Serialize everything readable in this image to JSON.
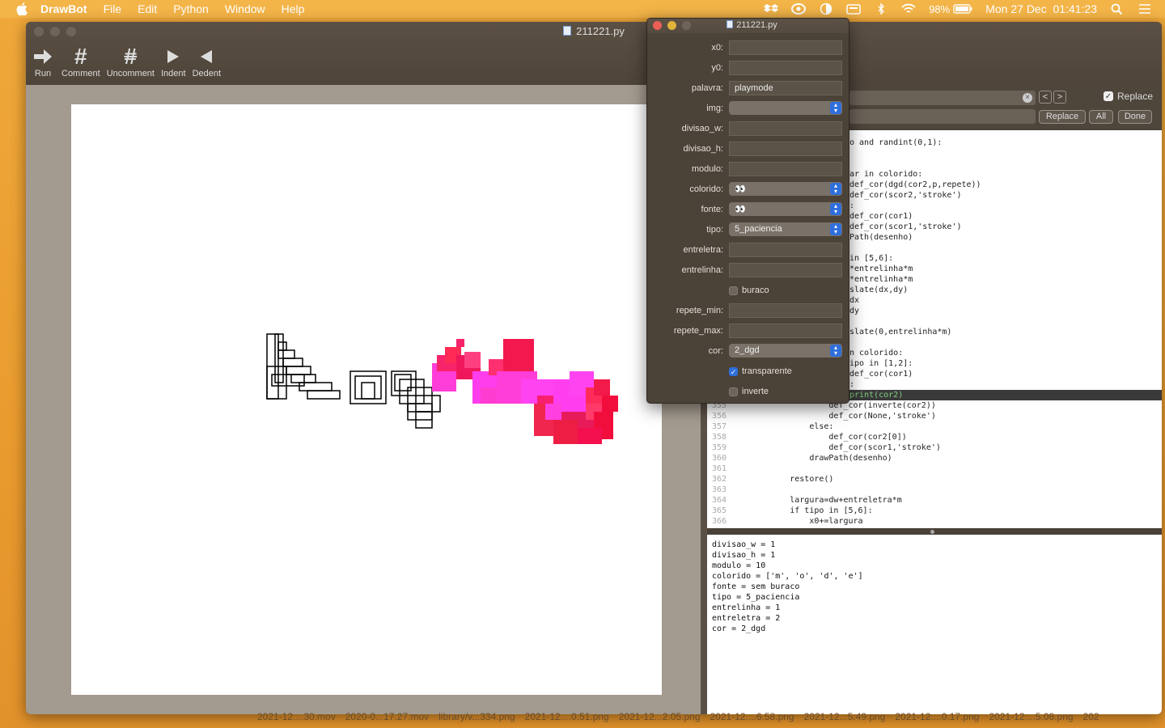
{
  "menubar": {
    "app": "DrawBot",
    "items": [
      "File",
      "Edit",
      "Python",
      "Window",
      "Help"
    ],
    "battery": "98%",
    "clock": "Mon 27 Dec  01:41:23"
  },
  "window": {
    "title": "211221.py",
    "toolbar": [
      "Run",
      "Comment",
      "Uncomment",
      "Indent",
      "Dedent"
    ]
  },
  "find": {
    "replace_label": "Replace",
    "btn_replace": "Replace",
    "btn_all": "All",
    "btn_done": "Done"
  },
  "code_lines": [
    {
      "n": "",
      "t": "o and randint(0,1):"
    },
    {
      "n": "",
      "t": ""
    },
    {
      "n": "",
      "t": ""
    },
    {
      "n": "",
      "t": "ar in colorido:"
    },
    {
      "n": "",
      "t": "def_cor(dgd(cor2,p,repete))"
    },
    {
      "n": "",
      "t": "def_cor(scor2,'stroke')"
    },
    {
      "n": "",
      "t": ":"
    },
    {
      "n": "",
      "t": "def_cor(cor1)"
    },
    {
      "n": "",
      "t": "def_cor(scor1,'stroke')"
    },
    {
      "n": "",
      "t": "Path(desenho)"
    },
    {
      "n": "",
      "t": ""
    },
    {
      "n": "",
      "t": "in [5,6]:"
    },
    {
      "n": "",
      "t": "*entrelinha*m"
    },
    {
      "n": "",
      "t": "*entrelinha*m"
    },
    {
      "n": "",
      "t": "slate(dx,dy)"
    },
    {
      "n": "",
      "t": "dx"
    },
    {
      "n": "",
      "t": "dy"
    },
    {
      "n": "",
      "t": ""
    },
    {
      "n": "",
      "t": "slate(0,entrelinha*m)"
    },
    {
      "n": "",
      "t": ""
    },
    {
      "n": "",
      "t": "n colorido:"
    },
    {
      "n": "",
      "t": "ipo in [1,2]:"
    },
    {
      "n": "",
      "t": "def_cor(cor1)"
    },
    {
      "n": "",
      "t": ":"
    },
    {
      "n": "",
      "t": "print(cor2)"
    },
    {
      "n": "355",
      "t": "                    def_cor(inverte(cor2))"
    },
    {
      "n": "356",
      "t": "                    def_cor(None,'stroke')"
    },
    {
      "n": "357",
      "t": "                else:"
    },
    {
      "n": "358",
      "t": "                    def_cor(cor2[0])"
    },
    {
      "n": "359",
      "t": "                    def_cor(scor1,'stroke')"
    },
    {
      "n": "360",
      "t": "                drawPath(desenho)"
    },
    {
      "n": "361",
      "t": ""
    },
    {
      "n": "362",
      "t": "            restore()"
    },
    {
      "n": "363",
      "t": ""
    },
    {
      "n": "364",
      "t": "            largura=dw+entreletra*m"
    },
    {
      "n": "365",
      "t": "            if tipo in [5,6]:"
    },
    {
      "n": "366",
      "t": "                x0+=largura"
    }
  ],
  "console": [
    "divisao_w = 1",
    "divisao_h = 1",
    "modulo = 10",
    "colorido = ['m', 'o', 'd', 'e']",
    "fonte = sem buraco",
    "tipo = 5_paciencia",
    "entrelinha = 1",
    "entreletra = 2",
    "cor = 2_dgd"
  ],
  "varpanel": {
    "title": "211221.py",
    "rows": [
      {
        "label": "x0:",
        "kind": "field",
        "value": ""
      },
      {
        "label": "y0:",
        "kind": "field",
        "value": ""
      },
      {
        "label": "palavra:",
        "kind": "field",
        "value": "playmode"
      },
      {
        "label": "img:",
        "kind": "popup",
        "value": ""
      },
      {
        "label": "divisao_w:",
        "kind": "field",
        "value": ""
      },
      {
        "label": "divisao_h:",
        "kind": "field",
        "value": ""
      },
      {
        "label": "modulo:",
        "kind": "field",
        "value": ""
      },
      {
        "label": "colorido:",
        "kind": "popup",
        "value": "👀"
      },
      {
        "label": "fonte:",
        "kind": "popup",
        "value": "👀"
      },
      {
        "label": "tipo:",
        "kind": "popup",
        "value": "5_paciencia"
      },
      {
        "label": "entreletra:",
        "kind": "field",
        "value": ""
      },
      {
        "label": "entrelinha:",
        "kind": "field",
        "value": ""
      },
      {
        "label": "",
        "kind": "check",
        "value": "buraco",
        "checked": false
      },
      {
        "label": "repete_min:",
        "kind": "field",
        "value": ""
      },
      {
        "label": "repete_max:",
        "kind": "field",
        "value": ""
      },
      {
        "label": "cor:",
        "kind": "popup",
        "value": "2_dgd"
      },
      {
        "label": "",
        "kind": "check",
        "value": "transparente",
        "checked": true
      },
      {
        "label": "",
        "kind": "check",
        "value": "inverte",
        "checked": false
      }
    ]
  },
  "dock_files": [
    "2021-12....30.mov",
    "2020-0...17.27.mov",
    "library/v...334.png",
    "2021-12....0.51.png",
    "2021-12...2.05.png",
    "2021-12....6.58.png",
    "2021-12...5.49.png",
    "2021-12....0.17.png",
    "2021-12....5.08.png",
    "202"
  ]
}
